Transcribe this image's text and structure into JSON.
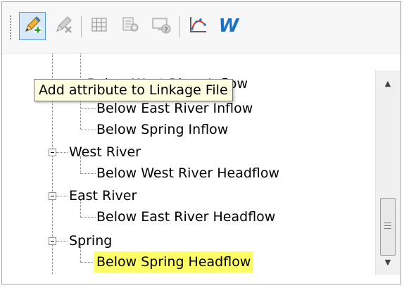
{
  "toolbar": {
    "buttons": [
      {
        "icon": "add-attribute-pencil-icon",
        "active": true
      },
      {
        "icon": "remove-attribute-pencil-icon",
        "active": false
      },
      {
        "icon": "table-grid-icon",
        "active": false
      },
      {
        "icon": "properties-icon",
        "active": false
      },
      {
        "icon": "help-icon",
        "active": false
      },
      {
        "icon": "chart-curve-icon",
        "active": false
      },
      {
        "icon": "w-logo-icon",
        "active": false
      }
    ],
    "w_label": "W"
  },
  "tooltip": {
    "text": "Add attribute to Linkage File"
  },
  "tree": {
    "partial_top_text": "Below West River Inflow",
    "nodes": [
      {
        "label": "Below East River Inflow",
        "level": 1
      },
      {
        "label": "Below Spring Inflow",
        "level": 1
      },
      {
        "label": "West River",
        "level": 0
      },
      {
        "label": "Below West River Headflow",
        "level": 1
      },
      {
        "label": "East River",
        "level": 0
      },
      {
        "label": "Below East River Headflow",
        "level": 1
      },
      {
        "label": "Spring",
        "level": 0
      },
      {
        "label": "Below Spring Headflow",
        "level": 1,
        "selected": true
      }
    ]
  },
  "scrollbar": {
    "up_arrow": "▲",
    "down_arrow": "▼"
  },
  "colors": {
    "selection": "#ffff66",
    "tooltip_bg": "#ffffe1",
    "active_button_border": "#5a9bd5",
    "w_logo": "#1e73be"
  }
}
